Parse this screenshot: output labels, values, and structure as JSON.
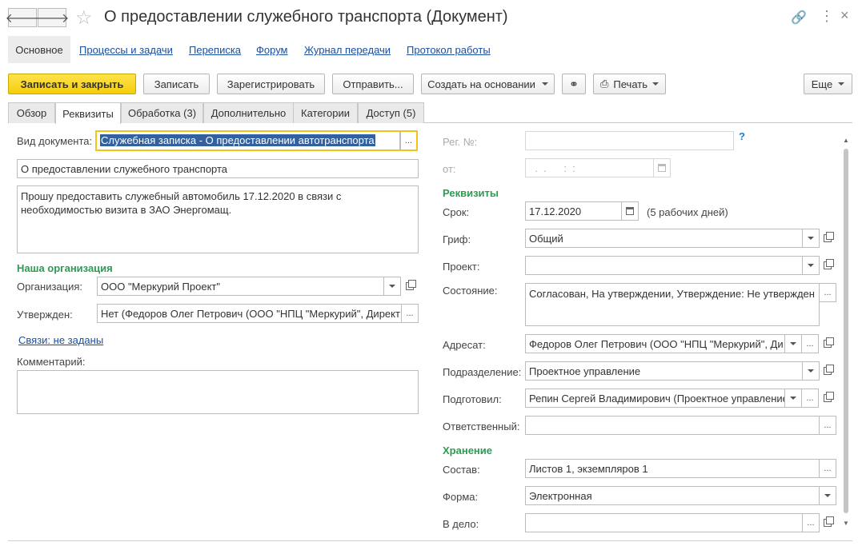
{
  "window": {
    "title": "О предоставлении служебного транспорта (Документ)",
    "more_icon": "⋮",
    "close_icon": "×",
    "link_icon": "🔗"
  },
  "nav": {
    "back": "🡐",
    "forward": "🡒"
  },
  "sections": [
    {
      "label": "Основное",
      "active": true
    },
    {
      "label": "Процессы и задачи"
    },
    {
      "label": "Переписка"
    },
    {
      "label": "Форум"
    },
    {
      "label": "Журнал передачи"
    },
    {
      "label": "Протокол работы"
    }
  ],
  "toolbar": {
    "save_close": "Записать и закрыть",
    "save": "Записать",
    "register": "Зарегистрировать",
    "send": "Отправить...",
    "create_based": "Создать на основании",
    "print": "Печать",
    "more": "Еще"
  },
  "tabs": [
    {
      "label": "Обзор"
    },
    {
      "label": "Реквизиты",
      "active": true
    },
    {
      "label": "Обработка (3)"
    },
    {
      "label": "Дополнительно"
    },
    {
      "label": "Категории"
    },
    {
      "label": "Доступ (5)"
    }
  ],
  "left": {
    "doc_type_label": "Вид документа:",
    "doc_type_value": "Служебная записка - О предоставлении автотранспорта",
    "subject": "О предоставлении служебного транспорта",
    "body": "Прошу предоставить служебный автомобиль 17.12.2020 в связи с\nнеобходимостью визита в ЗАО Энергомащ.",
    "org_group": "Наша организация",
    "org_label": "Организация:",
    "org_value": "ООО \"Меркурий Проект\"",
    "approved_label": "Утвержден:",
    "approved_value": "Нет (Федоров Олег Петрович (ООО \"НПЦ \"Меркурий\", Директ",
    "links": "Связи: не заданы",
    "comment_label": "Комментарий:",
    "comment_value": ""
  },
  "right": {
    "reg_label": "Рег. №:",
    "reg_value": "",
    "help": "?",
    "from_label": "от:",
    "from_value": "  .  .      :  :",
    "rekv_group": "Реквизиты",
    "due_label": "Срок:",
    "due_value": "17.12.2020",
    "due_note": "(5 рабочих дней)",
    "grif_label": "Гриф:",
    "grif_value": "Общий",
    "project_label": "Проект:",
    "project_value": "",
    "state_label": "Состояние:",
    "state_value": "Согласован, На утверждении, Утверждение: Не утвержден",
    "addressee_label": "Адресат:",
    "addressee_value": "Федоров Олег Петрович (ООО \"НПЦ \"Меркурий\", Ди",
    "dept_label": "Подразделение:",
    "dept_value": "Проектное управление",
    "prepared_label": "Подготовил:",
    "prepared_value": "Репин Сергей Владимирович (Проектное управление",
    "resp_label": "Ответственный:",
    "resp_value": "",
    "storage_group": "Хранение",
    "composition_label": "Состав:",
    "composition_value": "Листов 1, экземпляров 1",
    "form_label": "Форма:",
    "form_value": "Электронная",
    "file_label": "В дело:",
    "file_value": ""
  },
  "colors": {
    "accent_yellow": "#f5cc0b",
    "group_green": "#2e9a52",
    "link_blue": "#1a4fa0",
    "selection": "#33619f"
  }
}
